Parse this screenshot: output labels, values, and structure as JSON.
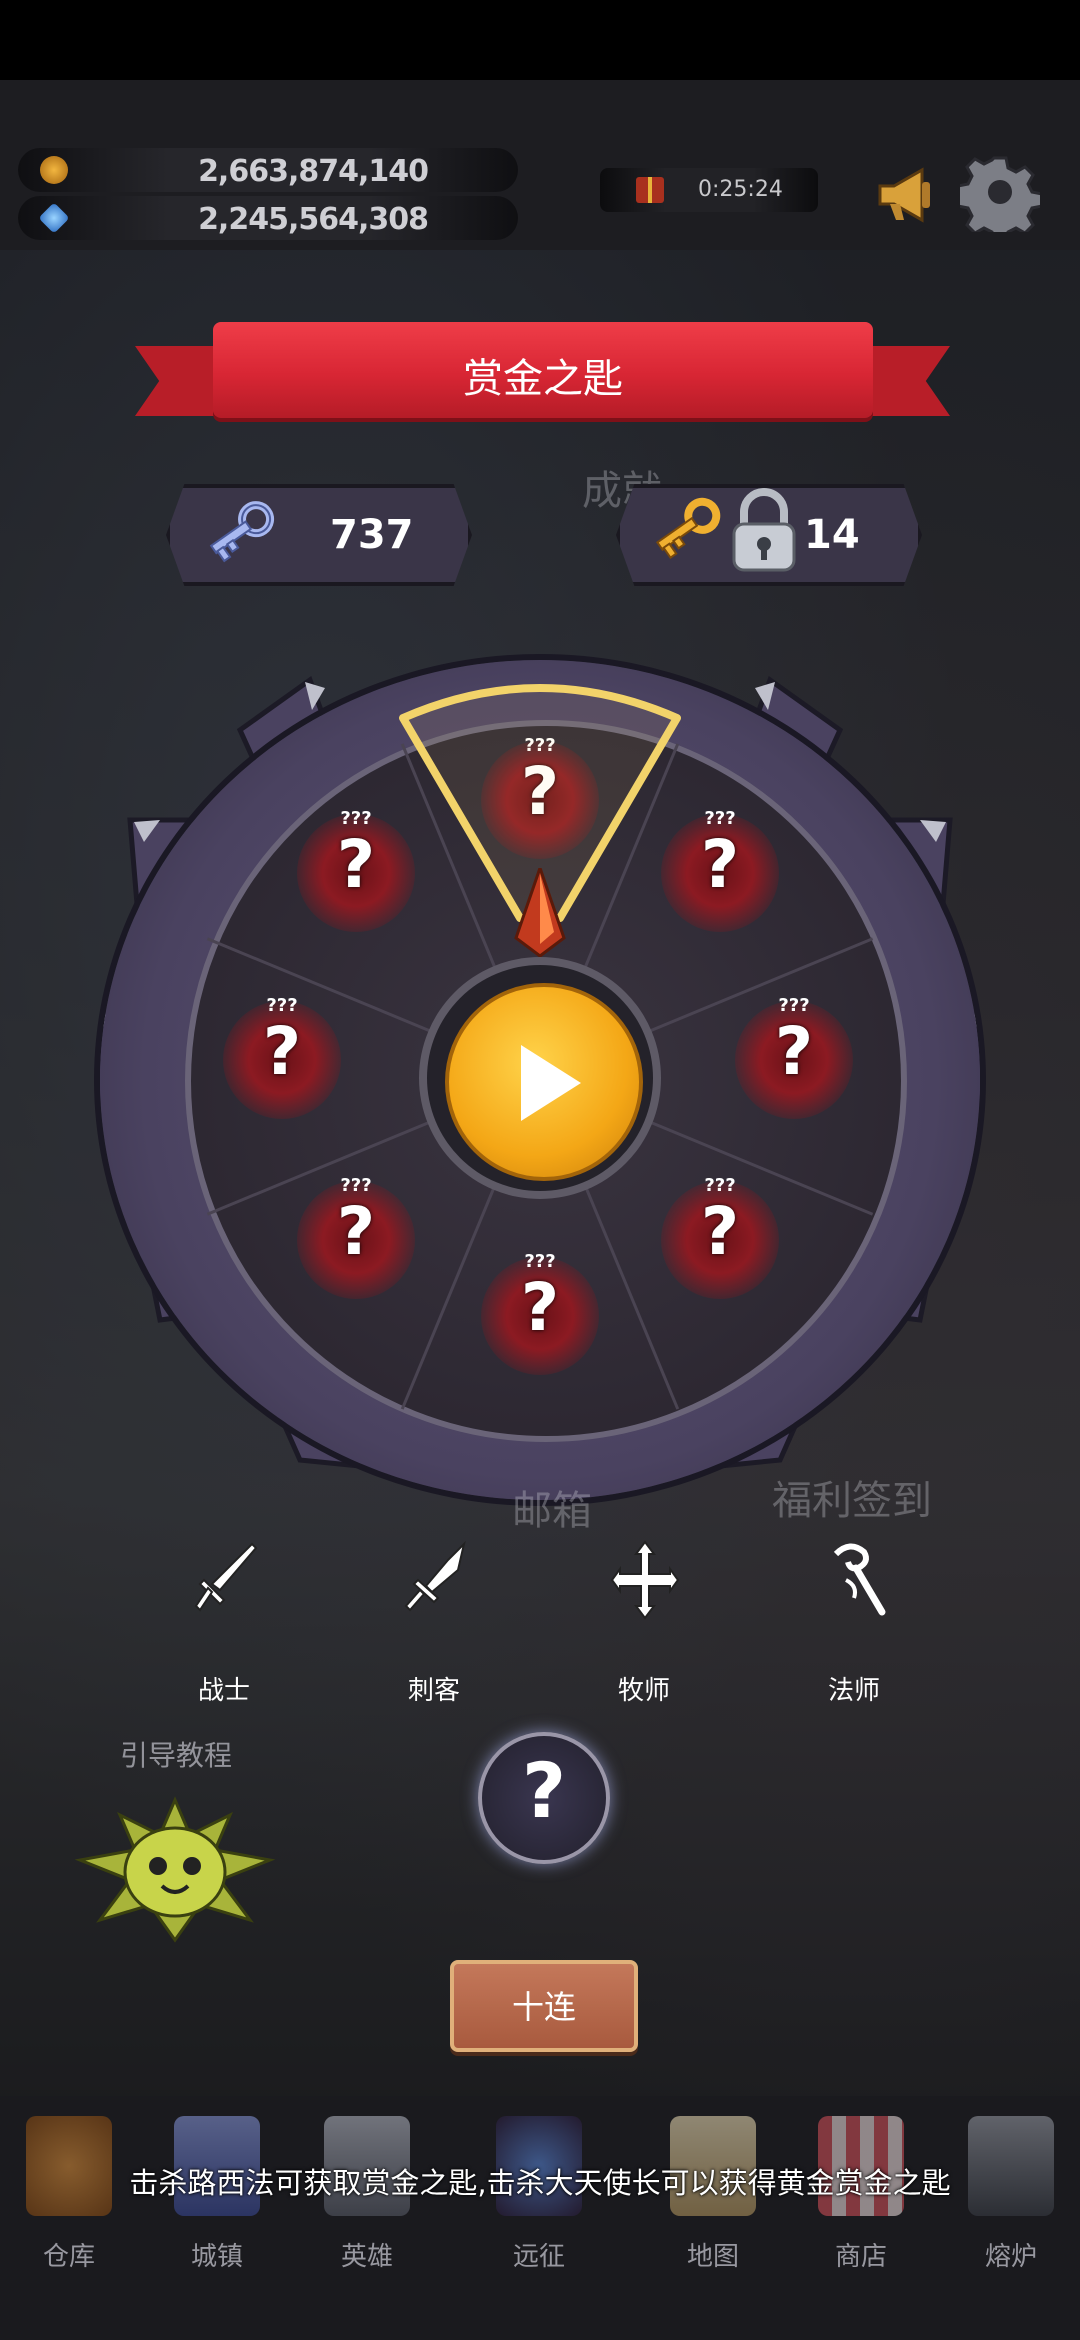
{
  "resources": {
    "gold": "2,663,874,140",
    "gems": "2,245,564,308"
  },
  "timer": "0:25:24",
  "title": "赏金之匙",
  "background_labels": {
    "achievement": "成就",
    "mailbox": "邮箱",
    "daily_signin": "福利签到"
  },
  "keys": {
    "bounty_keys": "737",
    "golden_keys": "14"
  },
  "wheel": {
    "slots": [
      {
        "small": "???",
        "big": "?"
      },
      {
        "small": "???",
        "big": "?"
      },
      {
        "small": "???",
        "big": "?"
      },
      {
        "small": "???",
        "big": "?"
      },
      {
        "small": "???",
        "big": "?"
      },
      {
        "small": "???",
        "big": "?"
      },
      {
        "small": "???",
        "big": "?"
      },
      {
        "small": "???",
        "big": "?"
      }
    ]
  },
  "classes": [
    {
      "label": "战士",
      "icon": "sword-icon"
    },
    {
      "label": "刺客",
      "icon": "dagger-icon"
    },
    {
      "label": "牧师",
      "icon": "holy-cross-icon"
    },
    {
      "label": "法师",
      "icon": "staff-icon"
    }
  ],
  "tutorial": "引导教程",
  "help_symbol": "?",
  "ten_pull": "十连",
  "tip": "击杀路西法可获取赏金之匙,击杀大天使长可以获得黄金赏金之匙",
  "nav": [
    {
      "label": "仓库",
      "color": "#c9792a"
    },
    {
      "label": "城镇",
      "color": "#5a6ab8"
    },
    {
      "label": "英雄",
      "color": "#8a8f9a"
    },
    {
      "label": "远征",
      "color": "#3b5aa0"
    },
    {
      "label": "地图",
      "color": "#d9c49a"
    },
    {
      "label": "商店",
      "color": "#b8404a"
    },
    {
      "label": "熔炉",
      "color": "#6c7078"
    }
  ],
  "colors": {
    "ribbon": "#d82634",
    "play_button": "#f4a716",
    "selector_outline": "#f2d36a"
  }
}
